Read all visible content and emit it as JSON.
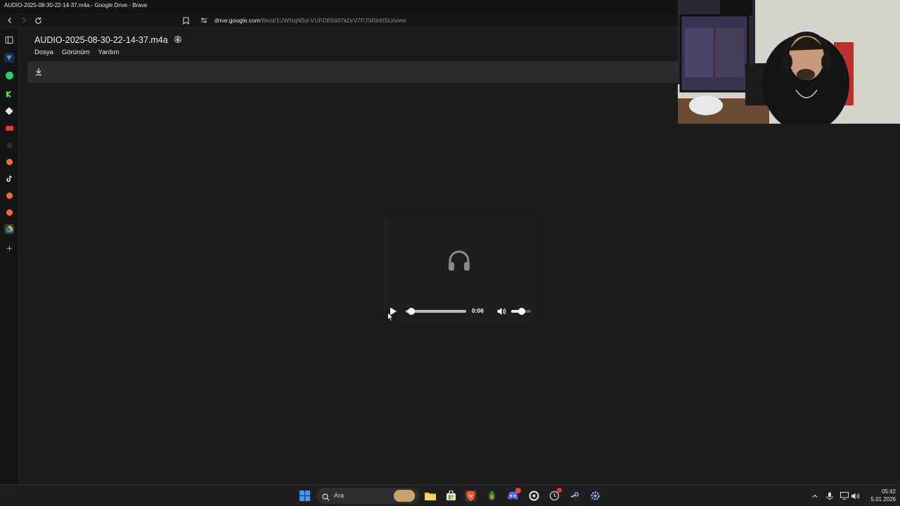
{
  "window": {
    "title": "AUDIO-2025-08-30-22-14-37.m4a - Google Drive - Brave"
  },
  "browser": {
    "url_host": "drive.google.com",
    "url_path": "/file/d/1UWNqNSd-VUFDB6667kDrV7PJSRlr6fSU/view"
  },
  "viewer": {
    "file_title": "AUDIO-2025-08-30-22-14-37.m4a",
    "menus": [
      "Dosya",
      "Görünüm",
      "Yardım"
    ]
  },
  "player": {
    "time": "0:06",
    "progress": 0.09,
    "volume": 0.55
  },
  "taskbar": {
    "search_label": "Ara",
    "time": "05:42",
    "date": "5.01.2026"
  },
  "colors": {
    "accent_drive_blue": "#4285f4",
    "whatsapp_green": "#25d366",
    "brave_orange": "#fb542b"
  }
}
